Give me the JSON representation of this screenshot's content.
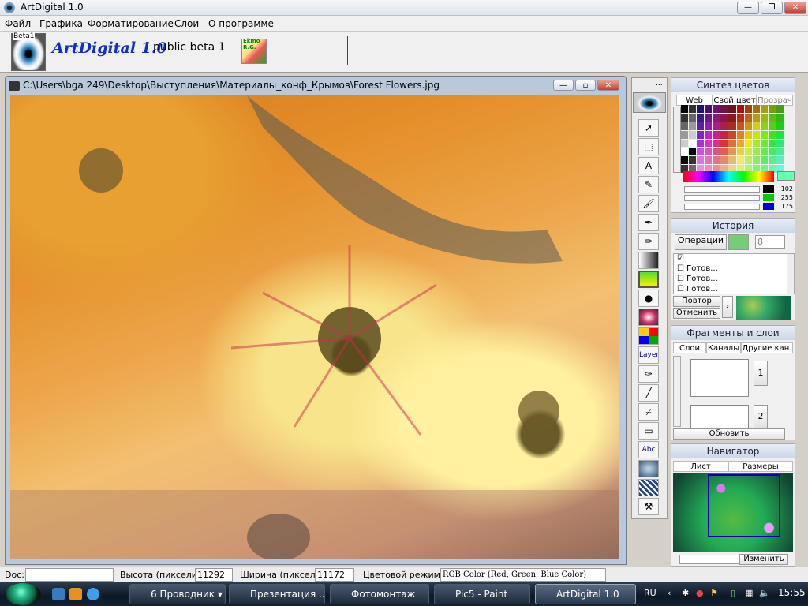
{
  "window": {
    "title": "ArtDigital 1.0"
  },
  "menu": [
    "Файл",
    "Графика",
    "Форматирование",
    "Слои",
    "О программе"
  ],
  "logo": {
    "beta_tag": "Beta1",
    "brand": "ArtDigital 1.0",
    "beta_text": "public beta 1",
    "ekmo_label": "Ekmo R.G."
  },
  "document": {
    "title": "C:\\Users\\bga 249\\Desktop\\Выступления\\Материалы_конф_Крымов\\Forest Flowers.jpg"
  },
  "tools": [
    "arrow-tool",
    "select-tool",
    "text-tool",
    "pencil-tool",
    "brush-tool",
    "stamp-tool",
    "airbrush-tool",
    "gradient-tool",
    "fill-tool",
    "bucket-tool",
    "radial-tool",
    "swatch-tool",
    "layer-tool",
    "pen-tool",
    "line-tool",
    "dropper-tool",
    "eraser-tool",
    "text-abc-tool",
    "frame-tool",
    "pattern-tool",
    "palette-knife-tool"
  ],
  "color_panel": {
    "title": "Синтез цветов",
    "tabs": [
      "Web",
      "Свой цвет",
      "Прозрач"
    ],
    "r": "102",
    "g": "255",
    "b": "175",
    "accent": "#66ffaf"
  },
  "history_panel": {
    "title": "История",
    "operations_label": "Операции",
    "count": "8",
    "items": [
      "",
      "Готов...",
      "Готов...",
      "Готов..."
    ],
    "redo": "Повтор",
    "undo": "Отменить"
  },
  "layers_panel": {
    "title": "Фрагменты и слои",
    "tabs": [
      "Слои",
      "Каналы",
      "Другие кан."
    ],
    "slot1": "1",
    "slot2": "2",
    "update": "Обновить"
  },
  "navigator_panel": {
    "title": "Навигатор",
    "tabs": [
      "Лист",
      "Размеры"
    ],
    "change": "Изменить"
  },
  "status": {
    "doc_label": "Doc:",
    "height_label": "Высота (пиксели):",
    "height": "11292",
    "width_label": "Ширина (пиксели):",
    "width": "11172",
    "mode_label": "Цветовой режим:",
    "mode": "RGB Color (Red, Green, Blue Color)"
  },
  "taskbar": {
    "tasks": [
      "6 Проводник",
      "Презентация ...",
      "Фотомонтаж",
      "Pic5 - Paint",
      "ArtDigital 1.0"
    ],
    "lang": "RU",
    "clock": "15:55"
  }
}
